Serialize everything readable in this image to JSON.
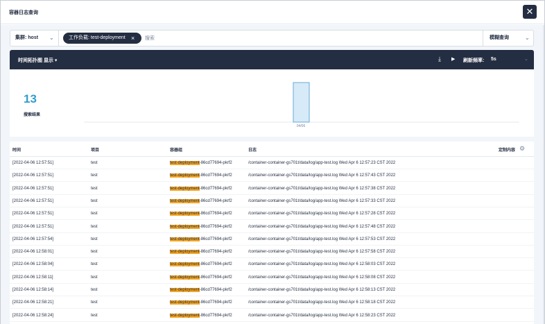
{
  "modal": {
    "title": "容器日志查询",
    "close_glyph": "✕"
  },
  "search": {
    "cluster_label": "集群: host",
    "chip_label": "工作负载: test-deployment",
    "chip_close": "×",
    "placeholder": "搜索",
    "mode_label": "模糊查询"
  },
  "toolbar": {
    "histogram_toggle": "时间拓扑图 显示",
    "refresh_label": "刷新频率:",
    "refresh_value": "5s"
  },
  "histogram": {
    "count": "13",
    "count_label": "搜索结果",
    "x_tick": "04/06",
    "bars": [
      {
        "x": "04/06",
        "value": 13
      }
    ]
  },
  "table": {
    "headers": {
      "time": "时间",
      "project": "项目",
      "container_group": "容器组",
      "log": "日志",
      "custom": "定制内容"
    },
    "rows": [
      {
        "time": "[2022-04-06 12:57:51]",
        "project": "test",
        "group_hl": "test-deployment",
        "group_rest": "-86cd77694-pkrf2",
        "log": "/container-container-gs701t/data/log/app-test.log Wed Apr 6 12:57:23 CST 2022"
      },
      {
        "time": "[2022-04-06 12:57:51]",
        "project": "test",
        "group_hl": "test-deployment",
        "group_rest": "-86cd77694-pkrf2",
        "log": "/container-container-gs701t/data/log/app-test.log Wed Apr 6 12:57:43 CST 2022"
      },
      {
        "time": "[2022-04-06 12:57:51]",
        "project": "test",
        "group_hl": "test-deployment",
        "group_rest": "-86cd77694-pkrf2",
        "log": "/container-container-gs701t/data/log/app-test.log Wed Apr 6 12:57:38 CST 2022"
      },
      {
        "time": "[2022-04-06 12:57:51]",
        "project": "test",
        "group_hl": "test-deployment",
        "group_rest": "-86cd77694-pkrf2",
        "log": "/container-container-gs701t/data/log/app-test.log Wed Apr 6 12:57:33 CST 2022"
      },
      {
        "time": "[2022-04-06 12:57:51]",
        "project": "test",
        "group_hl": "test-deployment",
        "group_rest": "-86cd77694-pkrf2",
        "log": "/container-container-gs701t/data/log/app-test.log Wed Apr 6 12:57:28 CST 2022"
      },
      {
        "time": "[2022-04-06 12:57:51]",
        "project": "test",
        "group_hl": "test-deployment",
        "group_rest": "-86cd77694-pkrf2",
        "log": "/container-container-gs701t/data/log/app-test.log Wed Apr 6 12:57:48 CST 2022"
      },
      {
        "time": "[2022-04-06 12:57:54]",
        "project": "test",
        "group_hl": "test-deployment",
        "group_rest": "-86cd77694-pkrf2",
        "log": "/container-container-gs701t/data/log/app-test.log Wed Apr 6 12:57:53 CST 2022"
      },
      {
        "time": "[2022-04-06 12:58:01]",
        "project": "test",
        "group_hl": "test-deployment",
        "group_rest": "-86cd77694-pkrf2",
        "log": "/container-container-gs701t/data/log/app-test.log Wed Apr 6 12:57:58 CST 2022"
      },
      {
        "time": "[2022-04-06 12:58:04]",
        "project": "test",
        "group_hl": "test-deployment",
        "group_rest": "-86cd77694-pkrf2",
        "log": "/container-container-gs701t/data/log/app-test.log Wed Apr 6 12:58:03 CST 2022"
      },
      {
        "time": "[2022-04-06 12:58:11]",
        "project": "test",
        "group_hl": "test-deployment",
        "group_rest": "-86cd77694-pkrf2",
        "log": "/container-container-gs701t/data/log/app-test.log Wed Apr 6 12:58:08 CST 2022"
      },
      {
        "time": "[2022-04-06 12:58:14]",
        "project": "test",
        "group_hl": "test-deployment",
        "group_rest": "-86cd77694-pkrf2",
        "log": "/container-container-gs701t/data/log/app-test.log Wed Apr 6 12:58:13 CST 2022"
      },
      {
        "time": "[2022-04-06 12:58:21]",
        "project": "test",
        "group_hl": "test-deployment",
        "group_rest": "-86cd77694-pkrf2",
        "log": "/container-container-gs701t/data/log/app-test.log Wed Apr 6 12:58:18 CST 2022"
      },
      {
        "time": "[2022-04-06 12:58:24]",
        "project": "test",
        "group_hl": "test-deployment",
        "group_rest": "-86cd77694-pkrf2",
        "log": "/container-container-gs701t/data/log/app-test.log Wed Apr 6 12:58:23 CST 2022"
      }
    ]
  },
  "icons": {
    "close": "close-icon",
    "chip_close": "close-icon",
    "dropdown": "chevron-down-icon",
    "download": "download-icon",
    "play": "play-icon",
    "settings": "gear-icon"
  },
  "colors": {
    "dark": "#242e42",
    "accent_count": "#329dce",
    "highlight": "#f5a623",
    "bar_fill": "#d7eaf7",
    "bar_stroke": "#64a9d9",
    "panel_bg": "#f2f5f9"
  }
}
